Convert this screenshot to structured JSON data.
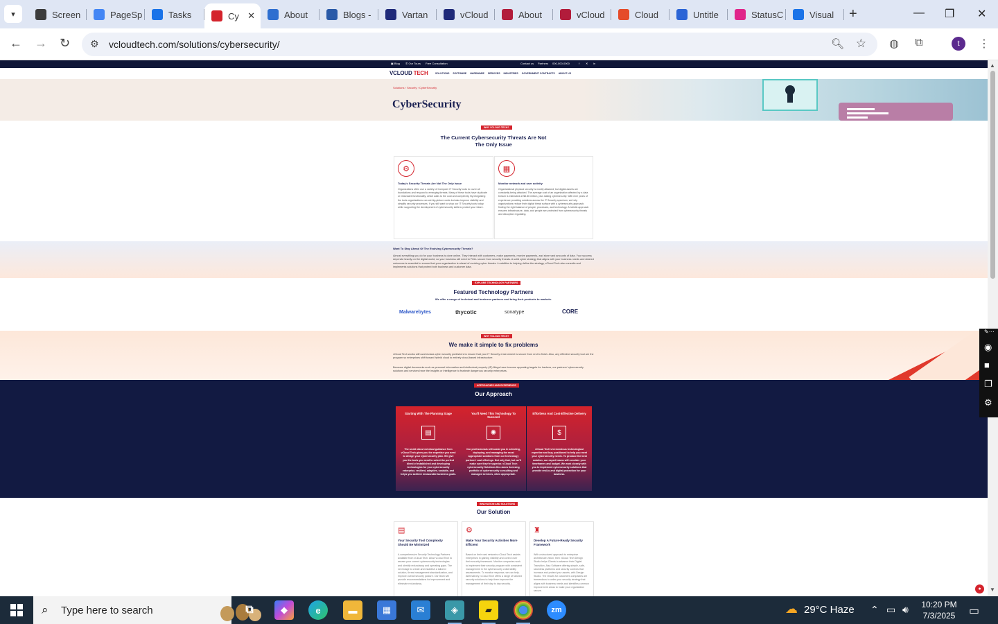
{
  "browser": {
    "tabs": [
      {
        "label": "Screen",
        "color": "#3c3c3c",
        "icon": "screencast-icon"
      },
      {
        "label": "PageSp",
        "color": "#4285f4",
        "icon": "pagespeed-icon"
      },
      {
        "label": "Tasks",
        "color": "#1a73e8",
        "icon": "tasks-icon"
      },
      {
        "label": "Cy",
        "color": "#d4232c",
        "icon": "vcloud-icon",
        "active": true
      },
      {
        "label": "About",
        "color": "#2f6fd0",
        "icon": "about-icon"
      },
      {
        "label": "Blogs -",
        "color": "#2a5aa8",
        "icon": "blogs-icon"
      },
      {
        "label": "Vartan",
        "color": "#1f2a7a",
        "icon": "x-icon"
      },
      {
        "label": "vCloud",
        "color": "#1f2a7a",
        "icon": "vcloud-check-icon"
      },
      {
        "label": "About",
        "color": "#b21c3b",
        "icon": "about-icon"
      },
      {
        "label": "vCloud",
        "color": "#b21c3b",
        "icon": "v-icon"
      },
      {
        "label": "Cloud",
        "color": "#e54b2a",
        "icon": "cloud-icon"
      },
      {
        "label": "Untitle",
        "color": "#2b64d6",
        "icon": "docs-icon"
      },
      {
        "label": "StatusC",
        "color": "#e0258a",
        "icon": "status-icon"
      },
      {
        "label": "Visual",
        "color": "#1a73e8",
        "icon": "visual-icon"
      }
    ],
    "url": "vcloudtech.com/solutions/cybersecurity/",
    "profile_initial": "t"
  },
  "site": {
    "logo_main": "VCLOUD ",
    "logo_accent": "TECH",
    "nav": [
      "SOLUTIONS",
      "SOFTWARE",
      "HARDWARE",
      "SERVICES",
      "INDUSTRIES",
      "GOVERNMENT CONTRACTS",
      "ABOUT US"
    ],
    "hero": {
      "breadcrumb": "Solutions › Security › CyberSecurity",
      "title": "CyberSecurity"
    },
    "threats": {
      "badge": "WHY VCLOUD TECH?",
      "heading_line1": "The Current Cybersecurity Threats Are Not",
      "heading_line2": "The Only Issue",
      "cards": [
        {
          "title": "Today's Security Threats Are Not The Only Issue",
          "text": "Organizations often use a variety of Computer IT Security tools to cover all foundations and respond to emerging threats. Many of these tools have duplicate or redundant functionality, which adds to the cost and complexity. By integrating the tools organizations can cut big-picture costs but also improve visibility and simplify security processes. If you still want to shop our IT Security tools today while supporting the development of cybersecurity skills to protect your future."
        },
        {
          "title": "Monitor network and user activity",
          "text": "Organizational physical security is mostly attacked, but digital assets are constantly being attacked. The average cost of an organization affected by a data breach is estimated at $3.86 million, plus lasting cybersecurity. With nine years of experience providing solutions across the IT Security spectrum, we help organizations reduce their digital threat surface with a cybersecurity approach, finding the right balance of people, processes, and technology. A holistic approach ensures infrastructure, data, and people are protected from cybersecurity threats and disruption regulating.",
          "unused": true
        }
      ]
    },
    "stay_ahead": {
      "title": "Want To Stay Ahead Of The Evolving Cybersecurity Threats?",
      "text": "Almost everything you do for your business is done online. They interact with customers, make payments, receive payments, and store vast amounts of data. Your success depends heavily on the digital world, so your business will need to FULL secure from security threats. A solid cyber strategy that aligns with your business needs and desired outcomes is essential to ensure that your organization is ahead of evolving cyber threats. In addition to helping define the strategy, vCloud Tech also consults and implements solutions that protect both business and customer data."
    },
    "partners": {
      "badge": "EXPLORE TECHNOLOGY PARTNERS",
      "heading": "Featured Technology Partners",
      "subheading": "We offer a range of technical and business partners and bring their products to markets.",
      "logos": [
        "Malwarebytes",
        "thycotic",
        "sonatype",
        "CORE"
      ]
    },
    "simple": {
      "badge": "WHY VCLOUD TECH?",
      "heading": "We make it simple to fix problems",
      "p1": "vCloud Tech works with world-class cyber security publishers to ensure that your IT Security environment is secure from end to finish. Also, any effective security tool are the program so enterprises shift toward hybrid cloud to entirely cloud-based infrastructure.",
      "p2": "Because digital documents such as personal information and intellectual property (IP) filings have become appealing targets for hackers, our partners' cybersecurity solutions and services have the insights or Intelligence to frustrate dangerous security enterprises."
    },
    "approach": {
      "badge": "APPROACHES AND EXPERIENCE",
      "heading": "Our Approach",
      "cards": [
        {
          "title": "Starting With The Planning Stage",
          "text": "The world class technical guidance from vCloud Tech gives you the expertise you need to design your cybersecurity plan. We give you the tools you need to select the perfect blend of established and developing technologies for your cybersecurity enterprise, resilient, adaptive, scalable, and helps you achieve measurable business goals."
        },
        {
          "title": "You'll Need This Technology To Succeed",
          "text": "Our professionals will assist you in selecting, deploying, and managing the most appropriate solutions from our technology partners' vast offerings. Not only that, but we'll make sure they're superior. vCloud Tech cybersecurity Solutions fine-tunes licensing portfolio of cybersecurity consulting and managed services, when appropriate."
        },
        {
          "title": "Effortless And Cost-Effective Delivery",
          "text": "vCloud Tech's tremendous technological expertise and buy, positioned to help you meet your cybersecurity needs. To produce the best solution, our expert teams will consider your timeframes and budget. We work closely with you to implement cybersecurity solutions that provide end-to-end digital protection for your business."
        }
      ]
    },
    "solution": {
      "badge": "INNOVATION AND SOLUTIONS",
      "heading": "Our Solution",
      "cards": [
        {
          "title": "Your Security Tool Complexity Should Be Minimized",
          "text": "A comprehensive Security Technology Partners available from vCloud Tech. Allow vCloud Tech to assess your current cybersecurity technologies and identify redundancy and operating gaps. The next stage to create and establish a tailored solution, threat management standardization, and improve overall security posture. Our team will provide recommendations for improvement and eliminate redundancy."
        },
        {
          "title": "Make Your Security Activities More Efficient",
          "text": "Based on their vast networks vCloud Tech assists enterprises in gaining visibility and control over their security framework. Monitor companies work to implement their security program with consistent management in the cybersecurity vulnerability assessments. To monitor response, we can help. Alternatively, vCloud Tech offers a range of tailored security solutions to help them improve the management of their day to day security."
        },
        {
          "title": "Develop A Future-Ready Security Framework",
          "text": "With a structured approach to enterprise architecture vision, then vCloud Tech Design Studio helps Clients to advance their Digital Transition. Also Software offering simple, safe, seamless platforms and security controls that increase and protect your assets, with Design Studio. The results for customers companies are tremendous to order your security strategy that aligns with business needs and identifies common improvement areas to make your organization secure."
        }
      ]
    }
  },
  "taskbar": {
    "search_placeholder": "Type here to search",
    "weather": "29°C  Haze",
    "time": "10:20 PM",
    "date": "7/3/2025"
  }
}
